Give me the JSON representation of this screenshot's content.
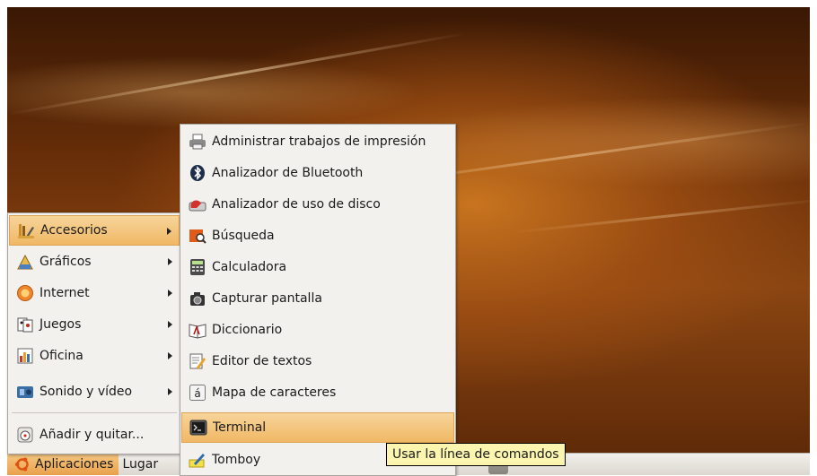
{
  "panel": {
    "applications_label": "Aplicaciones",
    "places_label": "Lugar"
  },
  "main_menu": {
    "items": [
      {
        "label": "Accesorios",
        "icon": "accessories-icon",
        "submenu": true,
        "active": true
      },
      {
        "label": "Gráficos",
        "icon": "graphics-icon",
        "submenu": true
      },
      {
        "label": "Internet",
        "icon": "internet-icon",
        "submenu": true
      },
      {
        "label": "Juegos",
        "icon": "games-icon",
        "submenu": true
      },
      {
        "label": "Oficina",
        "icon": "office-icon",
        "submenu": true
      },
      {
        "label": "Sonido y vídeo",
        "icon": "sound-video-icon",
        "submenu": true
      }
    ],
    "add_remove_label": "Añadir y quitar..."
  },
  "accessories_menu": {
    "items": [
      {
        "label": "Administrar trabajos de impresión",
        "icon": "printer-icon"
      },
      {
        "label": "Analizador de Bluetooth",
        "icon": "bluetooth-icon"
      },
      {
        "label": "Analizador de uso de disco",
        "icon": "disk-usage-icon"
      },
      {
        "label": "Búsqueda",
        "icon": "search-icon"
      },
      {
        "label": "Calculadora",
        "icon": "calculator-icon"
      },
      {
        "label": "Capturar pantalla",
        "icon": "camera-icon"
      },
      {
        "label": "Diccionario",
        "icon": "dictionary-icon"
      },
      {
        "label": "Editor de textos",
        "icon": "text-editor-icon"
      },
      {
        "label": "Mapa de caracteres",
        "icon": "character-map-icon"
      },
      {
        "label": "Terminal",
        "icon": "terminal-icon",
        "highlighted": true
      },
      {
        "label": "Tomboy",
        "icon": "tomboy-icon"
      }
    ]
  },
  "tooltip": {
    "text": "Usar la línea de comandos"
  },
  "colors": {
    "highlight": "#f0b865",
    "menu_bg": "#f3f1ee",
    "tooltip_bg": "#fbf5b0"
  }
}
